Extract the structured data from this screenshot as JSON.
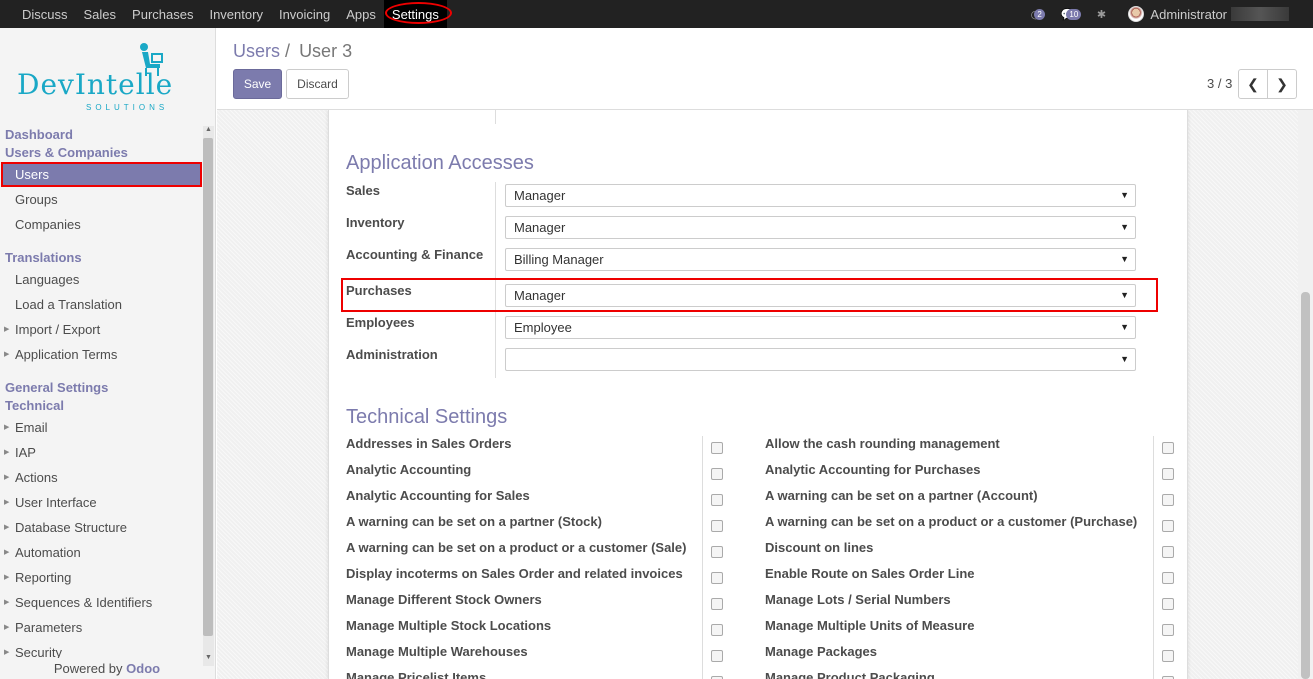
{
  "topnav": {
    "items": [
      "Discuss",
      "Sales",
      "Purchases",
      "Inventory",
      "Invoicing",
      "Apps",
      "Settings"
    ],
    "active": "Settings",
    "activity_count": "2",
    "message_count": "10",
    "user": "Administrator"
  },
  "logo": {
    "name": "DevIntelle",
    "sub": "SOLUTIONS"
  },
  "sidebar": {
    "groups": [
      {
        "title": "Dashboard",
        "items": []
      },
      {
        "title": "Users & Companies",
        "items": [
          {
            "label": "Users",
            "active": true,
            "expandable": false
          },
          {
            "label": "Groups",
            "expandable": false
          },
          {
            "label": "Companies",
            "expandable": false
          }
        ]
      },
      {
        "title": "Translations",
        "items": [
          {
            "label": "Languages",
            "expandable": false
          },
          {
            "label": "Load a Translation",
            "expandable": false
          },
          {
            "label": "Import / Export",
            "expandable": true
          },
          {
            "label": "Application Terms",
            "expandable": true
          }
        ]
      },
      {
        "title": "General Settings",
        "items": []
      },
      {
        "title": "Technical",
        "items": [
          {
            "label": "Email",
            "expandable": true
          },
          {
            "label": "IAP",
            "expandable": true
          },
          {
            "label": "Actions",
            "expandable": true
          },
          {
            "label": "User Interface",
            "expandable": true
          },
          {
            "label": "Database Structure",
            "expandable": true
          },
          {
            "label": "Automation",
            "expandable": true
          },
          {
            "label": "Reporting",
            "expandable": true
          },
          {
            "label": "Sequences & Identifiers",
            "expandable": true
          },
          {
            "label": "Parameters",
            "expandable": true
          },
          {
            "label": "Security",
            "expandable": true
          }
        ]
      }
    ],
    "powered_by": "Powered by",
    "powered_brand": "Odoo"
  },
  "control": {
    "breadcrumb_parent": "Users",
    "breadcrumb_sep": "/",
    "breadcrumb_current": "User 3",
    "save_label": "Save",
    "discard_label": "Discard",
    "pager": "3 / 3"
  },
  "form": {
    "access_title": "Application Accesses",
    "accesses": [
      {
        "label": "Sales",
        "value": "Manager"
      },
      {
        "label": "Inventory",
        "value": "Manager"
      },
      {
        "label": "Accounting & Finance",
        "value": "Billing Manager"
      },
      {
        "label": "Purchases",
        "value": "Manager"
      },
      {
        "label": "Employees",
        "value": "Employee"
      },
      {
        "label": "Administration",
        "value": ""
      }
    ],
    "tech_title": "Technical Settings",
    "tech_left": [
      "Addresses in Sales Orders",
      "Analytic Accounting",
      "Analytic Accounting for Sales",
      "A warning can be set on a partner (Stock)",
      "A warning can be set on a product or a customer (Sale)",
      "Display incoterms on Sales Order and related invoices",
      "Manage Different Stock Owners",
      "Manage Multiple Stock Locations",
      "Manage Multiple Warehouses",
      "Manage Pricelist Items"
    ],
    "tech_right": [
      "Allow the cash rounding management",
      "Analytic Accounting for Purchases",
      "A warning can be set on a partner (Account)",
      "A warning can be set on a product or a customer (Purchase)",
      "Discount on lines",
      "Enable Route on Sales Order Line",
      "Manage Lots / Serial Numbers",
      "Manage Multiple Units of Measure",
      "Manage Packages",
      "Manage Product Packaging"
    ]
  }
}
